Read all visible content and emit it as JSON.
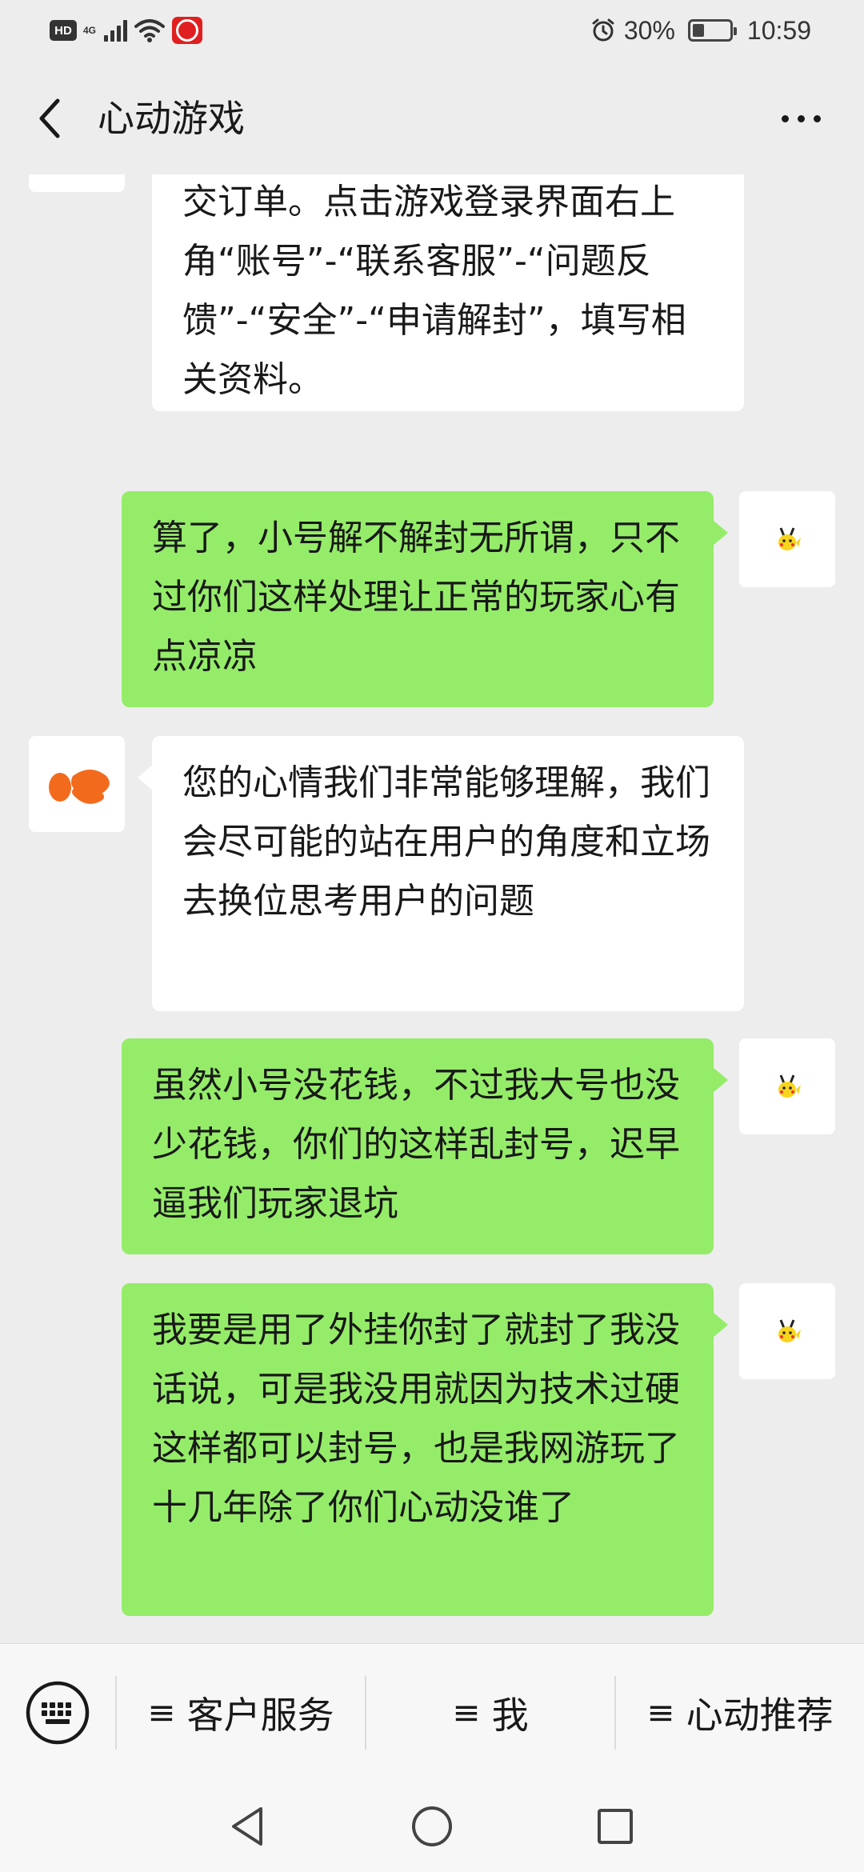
{
  "status_bar": {
    "hd": "HD",
    "network": "4G",
    "battery_percent": "30%",
    "time": "10:59"
  },
  "header": {
    "title": "心动游戏"
  },
  "messages": [
    {
      "side": "left",
      "text": "您的问题需您前往自助进行申请提交订单。点击游戏登录界面右上角“账号”-“联系客服”-“问题反馈”-“安全”-“申请解封”，填写相关资料。"
    },
    {
      "side": "right",
      "text": "算了，小号解不解封无所谓，只不过你们这样处理让正常的玩家心有点凉凉"
    },
    {
      "side": "left",
      "text": "您的心情我们非常能够理解，我们会尽可能的站在用户的角度和立场去换位思考用户的问题"
    },
    {
      "side": "right",
      "text": "虽然小号没花钱，不过我大号也没少花钱，你们的这样乱封号，迟早逼我们玩家退坑"
    },
    {
      "side": "right",
      "text": "我要是用了外挂你封了就封了我没话说，可是我没用就因为技术过硬这样都可以封号，也是我网游玩了十几年除了你们心动没谁了"
    }
  ],
  "bottom_menu": {
    "items": [
      {
        "icon": "≡",
        "label": "客户服务"
      },
      {
        "icon": "≡",
        "label": "我"
      },
      {
        "icon": "≡",
        "label": "心动推荐"
      }
    ]
  },
  "colors": {
    "accent_orange": "#f26b1d",
    "bubble_green": "#95ec69",
    "carrier_red": "#e02020"
  }
}
